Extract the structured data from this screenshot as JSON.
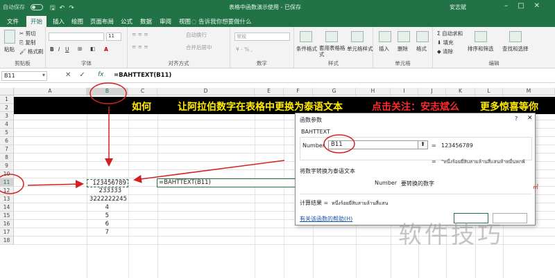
{
  "titlebar": {
    "autosave": "自动保存",
    "doc_title": "表格中函数演示使用 - 已保存",
    "user": "安志斌"
  },
  "tabs": [
    {
      "label": "文件"
    },
    {
      "label": "开始",
      "active": true
    },
    {
      "label": "插入"
    },
    {
      "label": "绘图"
    },
    {
      "label": "页面布局"
    },
    {
      "label": "公式"
    },
    {
      "label": "数据"
    },
    {
      "label": "审阅"
    },
    {
      "label": "视图"
    }
  ],
  "tell_me": "告诉我你想要做什么",
  "ribbon": {
    "clipboard": {
      "paste": "粘贴",
      "cut": "剪切",
      "copy": "复制",
      "format_painter": "格式刷",
      "label": "剪贴板"
    },
    "font": {
      "size": "11",
      "label": "字体"
    },
    "alignment": {
      "wrap": "自动换行",
      "merge": "合并后居中",
      "label": "对齐方式"
    },
    "number": {
      "format": "常规",
      "label": "数字"
    },
    "styles": {
      "conditional": "条件格式",
      "table": "套用表格格式",
      "cell": "单元格样式",
      "label": "样式"
    },
    "cells": {
      "insert": "插入",
      "delete": "删除",
      "format": "格式",
      "label": "单元格"
    },
    "editing": {
      "autosum": "自动求和",
      "fill": "填充",
      "clear": "清除",
      "sort": "排序和筛选",
      "find": "查找和选择",
      "label": "编辑"
    }
  },
  "formula_bar": {
    "name_box": "B11",
    "fx": "fx",
    "formula": "=BAHTTEXT(B11)"
  },
  "columns": [
    "A",
    "B",
    "C",
    "D",
    "E",
    "F",
    "G",
    "H",
    "I",
    "J",
    "K",
    "L",
    "M"
  ],
  "rows": [
    "1",
    "2",
    "3",
    "4",
    "5",
    "6",
    "7",
    "8",
    "9",
    "10",
    "11",
    "12",
    "13",
    "14",
    "15",
    "16",
    "17",
    "18"
  ],
  "banner": {
    "part1": "如何",
    "part2": "让阿拉伯数字在表格中更换为泰语文本",
    "part3": "点击关注：安志斌么",
    "part4": "更多惊喜等你"
  },
  "cells_b": [
    {
      "row": "11",
      "value": "123456789"
    },
    {
      "row": "12",
      "value": "233333"
    },
    {
      "row": "13",
      "value": "3222222245"
    },
    {
      "row": "14",
      "value": "4"
    },
    {
      "row": "15",
      "value": "5"
    },
    {
      "row": "16",
      "value": "6"
    },
    {
      "row": "17",
      "value": "7"
    }
  ],
  "formula_cell": "=BAHTTEXT(B11)",
  "dialog": {
    "title": "函数参数",
    "help": "?",
    "close": "✕",
    "function_name": "BAHTTEXT",
    "arg_label": "Number",
    "arg_value": "B11",
    "eq": "=",
    "arg_result": "123456789",
    "result_thai": "\"หนึ่งร้อยยี่สิบสามล้านสี่แสนห้าหมื่นหกพั",
    "description": "将数字转换为泰语文本",
    "arg_desc_name": "Number",
    "arg_desc": "要转换的数字",
    "result_label": "计算结果 =",
    "result_val": "หนึ่งร้อยยี่สิบสามล้านสี่แสน",
    "help_link": "有关该函数的帮助(H)"
  },
  "watermark": "软件技巧",
  "colors": {
    "excel_green": "#217346",
    "banner_yellow": "#ffeb00",
    "banner_red": "#ff2a2a",
    "annotation_red": "#d42020"
  }
}
